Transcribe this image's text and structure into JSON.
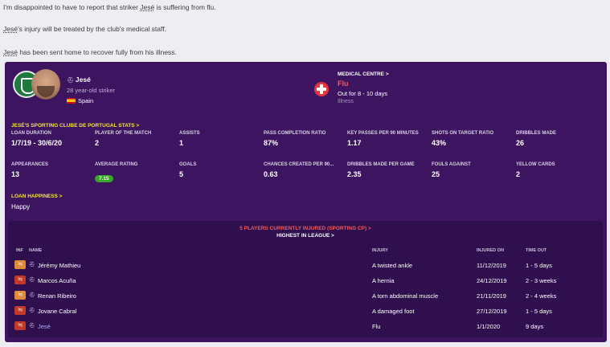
{
  "messages": [
    {
      "before": "I'm disappointed to have to report that striker ",
      "name": "Jesé",
      "after": " is suffering from flu."
    },
    {
      "before": "",
      "name": "Jesé",
      "after": "'s injury will be treated by the club's medical staff."
    },
    {
      "before": "",
      "name": "Jesé",
      "after": " has been sent home to recover fully from his illness."
    }
  ],
  "player": {
    "name": "Jesé",
    "description": "28 year-old striker",
    "nationality": "Spain",
    "flag_colors": [
      "#c60b1e",
      "#ffc400"
    ]
  },
  "medical": {
    "heading": "MEDICAL CENTRE >",
    "injury": "Flu",
    "out_for": "Out for 8 - 10 days",
    "category": "Illness",
    "accent": "#e4353b"
  },
  "stats": {
    "heading": "JESÉ'S SPORTING CLUBE DE PORTUGAL STATS >",
    "rows": [
      [
        {
          "label": "LOAN DURATION",
          "value": "1/7/19 - 30/6/20"
        },
        {
          "label": "PLAYER OF THE MATCH",
          "value": "2"
        },
        {
          "label": "ASSISTS",
          "value": "1"
        },
        {
          "label": "PASS COMPLETION RATIO",
          "value": "87%"
        },
        {
          "label": "KEY PASSES PER 90 MINUTES",
          "value": "1.17"
        },
        {
          "label": "SHOTS ON TARGET RATIO",
          "value": "43%"
        },
        {
          "label": "DRIBBLES MADE",
          "value": "26"
        }
      ],
      [
        {
          "label": "APPEARANCES",
          "value": "13"
        },
        {
          "label": "AVERAGE RATING",
          "value": "7.15"
        },
        {
          "label": "GOALS",
          "value": "5"
        },
        {
          "label": "CHANCES CREATED PER 90...",
          "value": "0.63"
        },
        {
          "label": "DRIBBLES MADE PER GAME",
          "value": "2.35"
        },
        {
          "label": "FOULS AGAINST",
          "value": "25"
        },
        {
          "label": "YELLOW CARDS",
          "value": "2"
        }
      ]
    ]
  },
  "loan": {
    "heading": "LOAN HAPPINESS >",
    "value": "Happy"
  },
  "injuries": {
    "summary": "5 PLAYERS CURRENTLY INJURED (SPORTING CP) >",
    "rank": "HIGHEST IN LEAGUE >",
    "columns": [
      "INF",
      "NAME",
      "INJURY",
      "INJURED ON",
      "TIME OUT"
    ],
    "rows": [
      {
        "inf": "Inj",
        "inf_color": "#e08a3c",
        "name": "Jérémy Mathieu",
        "injury": "A twisted ankle",
        "date": "11/12/2019",
        "time_out": "1 - 5 days"
      },
      {
        "inf": "Inj",
        "inf_color": "#c0392b",
        "name": "Marcos Acuña",
        "injury": "A hernia",
        "date": "24/12/2019",
        "time_out": "2 - 3 weeks"
      },
      {
        "inf": "Inj",
        "inf_color": "#e08a3c",
        "name": "Renan Ribeiro",
        "injury": "A torn abdominal muscle",
        "date": "21/11/2019",
        "time_out": "2 - 4 weeks"
      },
      {
        "inf": "Inj",
        "inf_color": "#c0392b",
        "name": "Jovane Cabral",
        "injury": "A damaged foot",
        "date": "27/12/2019",
        "time_out": "1 - 5 days"
      },
      {
        "inf": "Inj",
        "inf_color": "#c0392b",
        "name": "Jesé",
        "injury": "Flu",
        "date": "1/1/2020",
        "time_out": "9 days"
      }
    ]
  }
}
